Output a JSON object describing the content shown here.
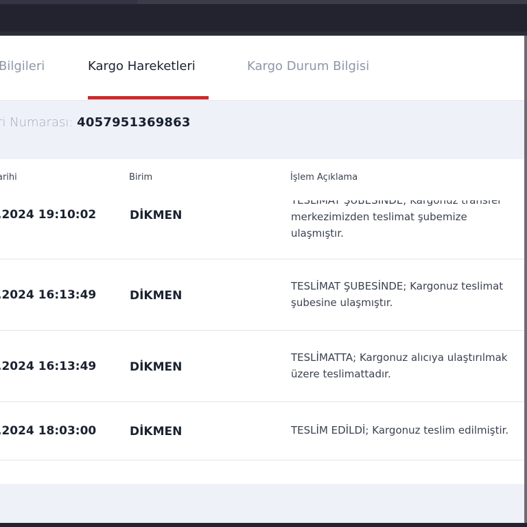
{
  "tabs": [
    {
      "label": "Bilgileri"
    },
    {
      "label": "Kargo Hareketleri"
    },
    {
      "label": "Kargo Durum Bilgisi"
    }
  ],
  "reference": {
    "label": "ri Numarası:",
    "value": "4057951369863"
  },
  "table": {
    "columns": [
      "arihi",
      "Birim",
      "İşlem Açıklama"
    ],
    "rows": [
      {
        "date": ".2024 19:10:02",
        "unit": "DİKMEN",
        "description": "TESLİMAT ŞUBESİNDE; Kargonuz transfer merkezimizden teslimat şubemize ulaşmıştır."
      },
      {
        "date": ".2024 16:13:49",
        "unit": "DİKMEN",
        "description": "TESLİMAT ŞUBESİNDE; Kargonuz teslimat şubesine ulaşmıştır."
      },
      {
        "date": ".2024 16:13:49",
        "unit": "DİKMEN",
        "description": "TESLİMATTA; Kargonuz alıcıya ulaştırılmak üzere teslimattadır."
      },
      {
        "date": ".2024 18:03:00",
        "unit": "DİKMEN",
        "description": "TESLİM EDİLDİ; Kargonuz teslim edilmiştir."
      }
    ]
  },
  "colors": {
    "accent": "#d12a2e",
    "text_dark": "#1a2130",
    "text_muted": "#8d96a8"
  }
}
